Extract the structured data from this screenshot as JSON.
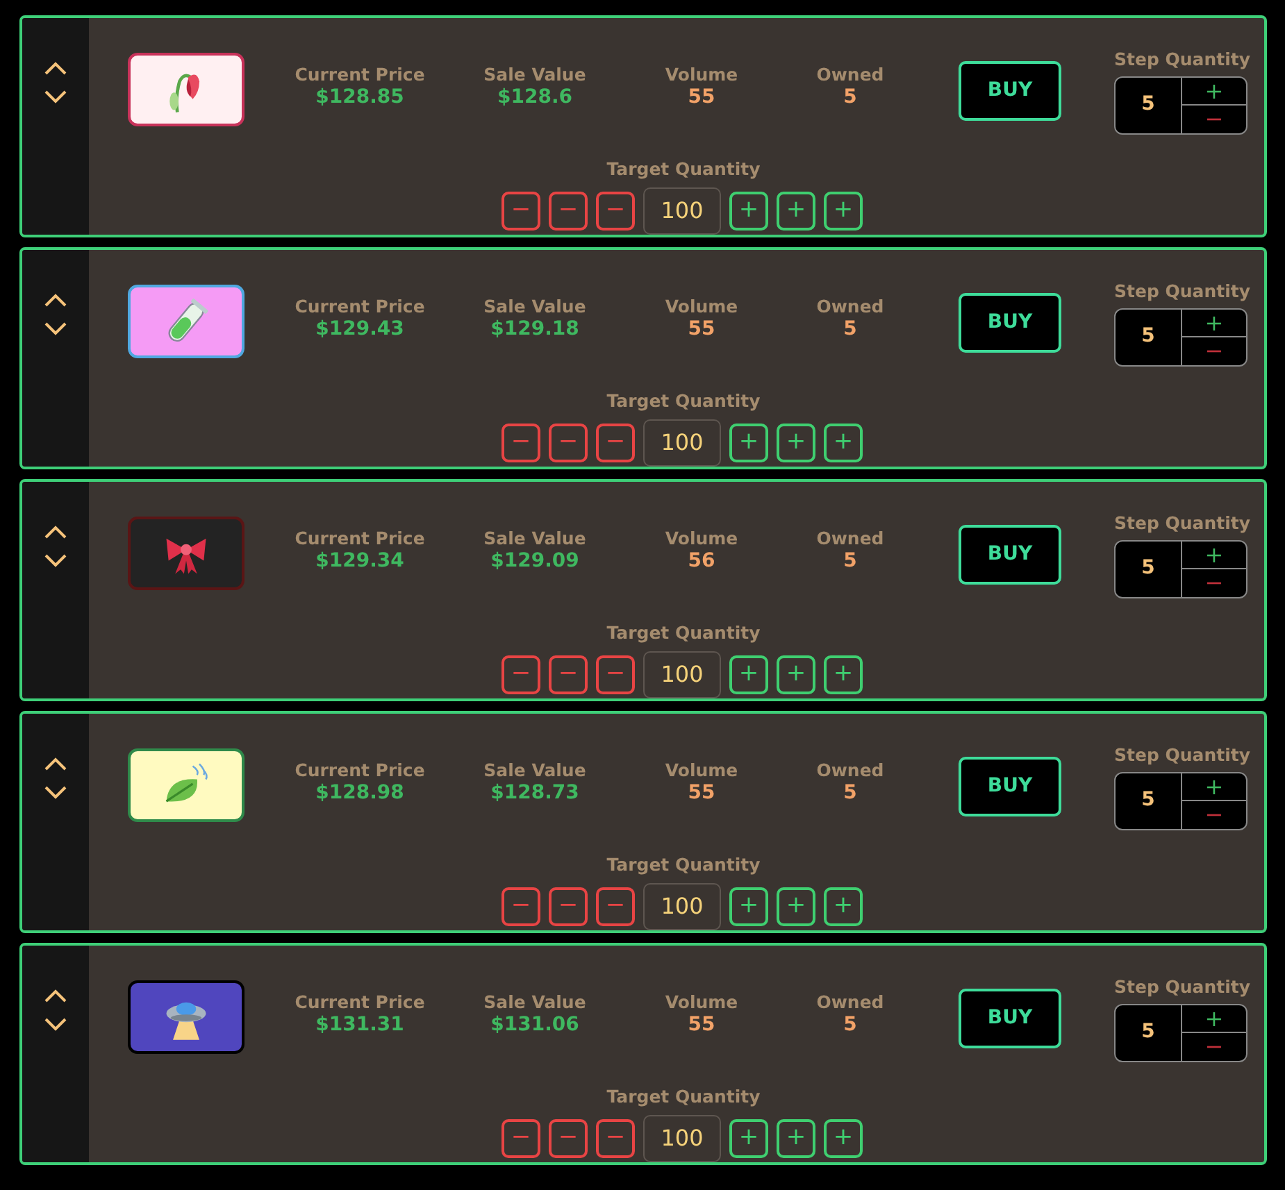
{
  "items": [
    {
      "kind": "flower",
      "color": "#fff0f2",
      "current_price_label": "Current Price",
      "current_price": "$128.85",
      "sale_value_label": "Sale Value",
      "sale_value": "$128.6",
      "volume_label": "Volume",
      "volume": "55",
      "owned_label": "Owned",
      "owned": "5",
      "buy": "BUY",
      "step_label": "Step Quantity",
      "step_quantity": "5",
      "step_plus": "+",
      "step_minus": "−",
      "target_label": "Target Quantity",
      "minus_buttons": [
        "−",
        "−",
        "−"
      ],
      "target_quantity": "100",
      "plus_buttons": [
        "+",
        "+",
        "+"
      ]
    },
    {
      "kind": "tube",
      "color": "#f59bf5",
      "current_price_label": "Current Price",
      "current_price": "$129.43",
      "sale_value_label": "Sale Value",
      "sale_value": "$129.18",
      "volume_label": "Volume",
      "volume": "55",
      "owned_label": "Owned",
      "owned": "5",
      "buy": "BUY",
      "step_label": "Step Quantity",
      "step_quantity": "5",
      "step_plus": "+",
      "step_minus": "−",
      "target_label": "Target Quantity",
      "minus_buttons": [
        "−",
        "−",
        "−"
      ],
      "target_quantity": "100",
      "plus_buttons": [
        "+",
        "+",
        "+"
      ]
    },
    {
      "kind": "bow",
      "color": "#232323",
      "current_price_label": "Current Price",
      "current_price": "$129.34",
      "sale_value_label": "Sale Value",
      "sale_value": "$129.09",
      "volume_label": "Volume",
      "volume": "56",
      "owned_label": "Owned",
      "owned": "5",
      "buy": "BUY",
      "step_label": "Step Quantity",
      "step_quantity": "5",
      "step_plus": "+",
      "step_minus": "−",
      "target_label": "Target Quantity",
      "minus_buttons": [
        "−",
        "−",
        "−"
      ],
      "target_quantity": "100",
      "plus_buttons": [
        "+",
        "+",
        "+"
      ]
    },
    {
      "kind": "leaf",
      "color": "#fffac0",
      "current_price_label": "Current Price",
      "current_price": "$128.98",
      "sale_value_label": "Sale Value",
      "sale_value": "$128.73",
      "volume_label": "Volume",
      "volume": "55",
      "owned_label": "Owned",
      "owned": "5",
      "buy": "BUY",
      "step_label": "Step Quantity",
      "step_quantity": "5",
      "step_plus": "+",
      "step_minus": "−",
      "target_label": "Target Quantity",
      "minus_buttons": [
        "−",
        "−",
        "−"
      ],
      "target_quantity": "100",
      "plus_buttons": [
        "+",
        "+",
        "+"
      ]
    },
    {
      "kind": "ufo",
      "color": "#5046be",
      "current_price_label": "Current Price",
      "current_price": "$131.31",
      "sale_value_label": "Sale Value",
      "sale_value": "$131.06",
      "volume_label": "Volume",
      "volume": "55",
      "owned_label": "Owned",
      "owned": "5",
      "buy": "BUY",
      "step_label": "Step Quantity",
      "step_quantity": "5",
      "step_plus": "+",
      "step_minus": "−",
      "target_label": "Target Quantity",
      "minus_buttons": [
        "−",
        "−",
        "−"
      ],
      "target_quantity": "100",
      "plus_buttons": [
        "+",
        "+",
        "+"
      ]
    }
  ]
}
